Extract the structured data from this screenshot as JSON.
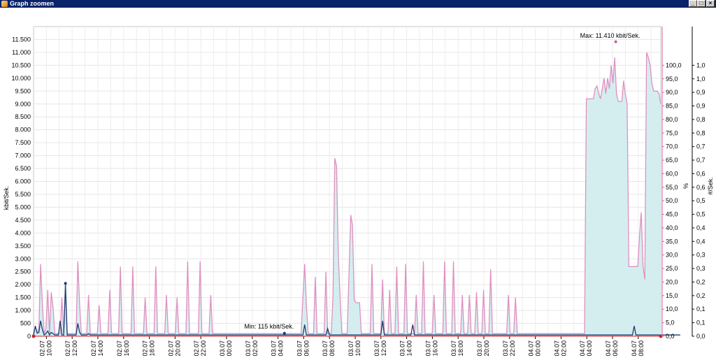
{
  "window": {
    "title": "Graph zoomen",
    "icons": [
      "app-icon",
      "minimize-icon",
      "maximize-icon",
      "close-icon"
    ]
  },
  "chart_data": {
    "type": "area",
    "ylabel_left": "kbit/Sek.",
    "ylabel_right1": "%",
    "ylabel_right2": "#/Sek.",
    "yticks_left": [
      "0",
      "500",
      "1.000",
      "1.500",
      "2.000",
      "2.500",
      "3.000",
      "3.500",
      "4.000",
      "4.500",
      "5.000",
      "5.500",
      "6.000",
      "6.500",
      "7.000",
      "7.500",
      "8.000",
      "8.500",
      "9.000",
      "9.500",
      "10.000",
      "10.500",
      "11.000",
      "11.500"
    ],
    "yticks_right1": [
      "0,0",
      "5,0",
      "10,0",
      "15,0",
      "20,0",
      "25,0",
      "30,0",
      "35,0",
      "40,0",
      "45,0",
      "50,0",
      "55,0",
      "60,0",
      "65,0",
      "70,0",
      "75,0",
      "80,0",
      "85,0",
      "90,0",
      "95,0",
      "100,0"
    ],
    "yticks_right2": [
      "0,0",
      "0,1",
      "0,1",
      "0,2",
      "0,2",
      "0,3",
      "0,3",
      "0,4",
      "0,4",
      "0,5",
      "0,5",
      "0,6",
      "0,6",
      "0,7",
      "0,7",
      "0,8",
      "0,8",
      "0,9",
      "0,9",
      "1,0",
      "1,0"
    ],
    "ylim_left": [
      0,
      12000
    ],
    "x_tick_labels": [
      [
        "02.07",
        "10:00"
      ],
      [
        "02.07",
        "12:00"
      ],
      [
        "02.07",
        "14:00"
      ],
      [
        "02.07",
        "16:00"
      ],
      [
        "02.07",
        "18:00"
      ],
      [
        "02.07",
        "20:00"
      ],
      [
        "02.07",
        "22:00"
      ],
      [
        "03.07",
        "00:00"
      ],
      [
        "03.07",
        "02:00"
      ],
      [
        "03.07",
        "04:00"
      ],
      [
        "03.07",
        "06:00"
      ],
      [
        "03.07",
        "08:00"
      ],
      [
        "03.07",
        "10:00"
      ],
      [
        "03.07",
        "12:00"
      ],
      [
        "03.07",
        "14:00"
      ],
      [
        "03.07",
        "16:00"
      ],
      [
        "03.07",
        "18:00"
      ],
      [
        "03.07",
        "20:00"
      ],
      [
        "03.07",
        "22:00"
      ],
      [
        "04.07",
        "00:00"
      ],
      [
        "04.07",
        "02:00"
      ],
      [
        "04.07",
        "04:00"
      ],
      [
        "04.07",
        "06:00"
      ],
      [
        "04.07",
        "08:00"
      ]
    ],
    "x_start": "02.07 09:00",
    "x_end": "04.07 09:45",
    "x_step_minutes": 15,
    "series": [
      {
        "name": "",
        "color": "#e090c0",
        "fill": "#d4eef0",
        "values": [
          100,
          350,
          150,
          300,
          2800,
          1200,
          100,
          300,
          1800,
          100,
          1700,
          1100,
          100,
          100,
          100,
          100,
          1500,
          100,
          1700,
          100,
          100,
          100,
          100,
          100,
          100,
          2900,
          1200,
          100,
          100,
          100,
          100,
          1600,
          100,
          100,
          100,
          100,
          100,
          1200,
          100,
          100,
          100,
          100,
          100,
          1800,
          100,
          100,
          100,
          100,
          100,
          2700,
          100,
          100,
          100,
          100,
          100,
          100,
          2700,
          100,
          100,
          100,
          100,
          100,
          100,
          1500,
          100,
          100,
          100,
          100,
          100,
          2700,
          100,
          100,
          100,
          100,
          100,
          1600,
          100,
          100,
          100,
          100,
          100,
          1500,
          100,
          100,
          100,
          100,
          100,
          2900,
          100,
          100,
          100,
          100,
          100,
          100,
          2900,
          100,
          100,
          100,
          100,
          100,
          1600,
          100,
          100,
          100,
          100,
          100,
          100,
          100,
          100,
          100,
          100,
          100,
          100,
          100,
          100,
          100,
          100,
          100,
          100,
          100,
          100,
          100,
          100,
          100,
          100,
          100,
          100,
          100,
          100,
          100,
          100,
          100,
          100,
          100,
          100,
          100,
          100,
          100,
          100,
          100,
          100,
          100,
          100,
          100,
          100,
          100,
          100,
          100,
          100,
          100,
          100,
          100,
          1500,
          2800,
          1200,
          100,
          100,
          100,
          100,
          2300,
          100,
          100,
          100,
          100,
          100,
          2500,
          100,
          100,
          100,
          1500,
          6900,
          6600,
          3200,
          1500,
          100,
          100,
          100,
          100,
          2300,
          4700,
          4300,
          1400,
          1300,
          1300,
          1300,
          100,
          100,
          100,
          100,
          100,
          100,
          2800,
          100,
          100,
          100,
          100,
          100,
          2200,
          100,
          100,
          100,
          1800,
          100,
          100,
          100,
          2700,
          100,
          100,
          100,
          100,
          2800,
          100,
          100,
          100,
          100,
          100,
          1600,
          100,
          100,
          100,
          2900,
          100,
          100,
          100,
          100,
          100,
          1600,
          100,
          100,
          100,
          100,
          100,
          2900,
          100,
          100,
          100,
          100,
          2900,
          100,
          100,
          100,
          100,
          1600,
          100,
          100,
          100,
          1600,
          100,
          100,
          100,
          1700,
          100,
          100,
          100,
          1800,
          100,
          100,
          100,
          2600,
          100,
          100,
          100,
          100,
          100,
          100,
          100,
          100,
          100,
          1600,
          100,
          100,
          100,
          1500,
          100,
          100,
          100,
          100,
          100,
          100,
          100,
          100,
          100,
          100,
          100,
          100,
          100,
          100,
          100,
          100,
          100,
          100,
          100,
          100,
          100,
          100,
          100,
          100,
          100,
          100,
          100,
          100,
          100,
          100,
          100,
          100,
          100,
          100,
          100,
          100,
          100,
          100,
          100,
          9200,
          9200,
          9200,
          9200,
          9200,
          9600,
          9700,
          9400,
          9200,
          9600,
          10000,
          9400,
          10000,
          9600,
          10500,
          9800,
          10800,
          9400,
          9100,
          9100,
          9100,
          9900,
          9400,
          9000,
          2700,
          2700,
          2700,
          2700,
          2700,
          2700,
          3900,
          4800,
          2700,
          2200,
          11000,
          10800,
          10500,
          9800,
          9500,
          9500,
          9500,
          9400,
          9000
        ]
      },
      {
        "name": "",
        "color": "#1f3d70",
        "values": [
          50,
          400,
          120,
          150,
          600,
          250,
          50,
          100,
          200,
          50,
          150,
          100,
          50,
          50,
          50,
          600,
          50,
          50,
          2050,
          50,
          50,
          50,
          50,
          50,
          50,
          500,
          150,
          50,
          50,
          50,
          50,
          100,
          50,
          50,
          50,
          50,
          50,
          50,
          50,
          50,
          50,
          50,
          50,
          50,
          50,
          50,
          50,
          50,
          50,
          50,
          50,
          50,
          50,
          50,
          50,
          50,
          50,
          50,
          50,
          50,
          50,
          50,
          50,
          50,
          50,
          50,
          50,
          50,
          50,
          50,
          50,
          50,
          50,
          50,
          50,
          50,
          50,
          50,
          50,
          50,
          50,
          50,
          50,
          50,
          50,
          50,
          50,
          50,
          50,
          50,
          50,
          50,
          50,
          50,
          50,
          50,
          50,
          50,
          50,
          50,
          50,
          50,
          50,
          50,
          50,
          50,
          50,
          50,
          50,
          50,
          50,
          50,
          50,
          50,
          50,
          50,
          50,
          50,
          50,
          50,
          50,
          50,
          50,
          50,
          50,
          50,
          50,
          50,
          50,
          50,
          50,
          50,
          50,
          50,
          50,
          50,
          50,
          50,
          50,
          50,
          50,
          50,
          50,
          50,
          50,
          50,
          50,
          50,
          50,
          50,
          50,
          50,
          50,
          450,
          50,
          50,
          50,
          50,
          50,
          50,
          50,
          50,
          50,
          50,
          50,
          50,
          300,
          50,
          50,
          50,
          50,
          50,
          50,
          50,
          50,
          50,
          50,
          50,
          50,
          50,
          50,
          50,
          50,
          50,
          50,
          50,
          50,
          50,
          50,
          50,
          50,
          50,
          50,
          50,
          50,
          50,
          50,
          600,
          50,
          50,
          50,
          50,
          50,
          50,
          50,
          50,
          50,
          50,
          50,
          50,
          50,
          50,
          50,
          50,
          450,
          50,
          50,
          50,
          50,
          50,
          50,
          50,
          50,
          50,
          50,
          50,
          50,
          50,
          50,
          50,
          50,
          50,
          50,
          50,
          50,
          50,
          50,
          50,
          50,
          50,
          50,
          50,
          50,
          50,
          50,
          50,
          50,
          50,
          50,
          50,
          50,
          50,
          50,
          50,
          50,
          50,
          50,
          50,
          50,
          50,
          50,
          50,
          50,
          50,
          50,
          50,
          50,
          50,
          50,
          50,
          50,
          50,
          50,
          50,
          50,
          50,
          50,
          50,
          50,
          50,
          50,
          50,
          50,
          50,
          50,
          50,
          50,
          50,
          50,
          50,
          50,
          50,
          50,
          50,
          50,
          50,
          50,
          50,
          50,
          50,
          50,
          50,
          50,
          50,
          50,
          50,
          50,
          50,
          50,
          50,
          50,
          50,
          50,
          50,
          50,
          50,
          50,
          50,
          50,
          50,
          50,
          50,
          50,
          50,
          50,
          50,
          50,
          50,
          50,
          50,
          50,
          50,
          50,
          50,
          50,
          50,
          50,
          50,
          50,
          400,
          50,
          50,
          50,
          50,
          50,
          50,
          50,
          50,
          50,
          50,
          50,
          50,
          50,
          50,
          50,
          50,
          50,
          50,
          50,
          50,
          50,
          50,
          50,
          50,
          50,
          50
        ]
      }
    ],
    "annotations": [
      {
        "text": "Max: 11.410 kbit/Sek.",
        "x": "04.07 06:15",
        "y": 11410
      },
      {
        "text": "Min: 115 kbit/Sek.",
        "x": "03.07 04:30",
        "y": 115
      }
    ],
    "grid": true,
    "legend": "none"
  }
}
